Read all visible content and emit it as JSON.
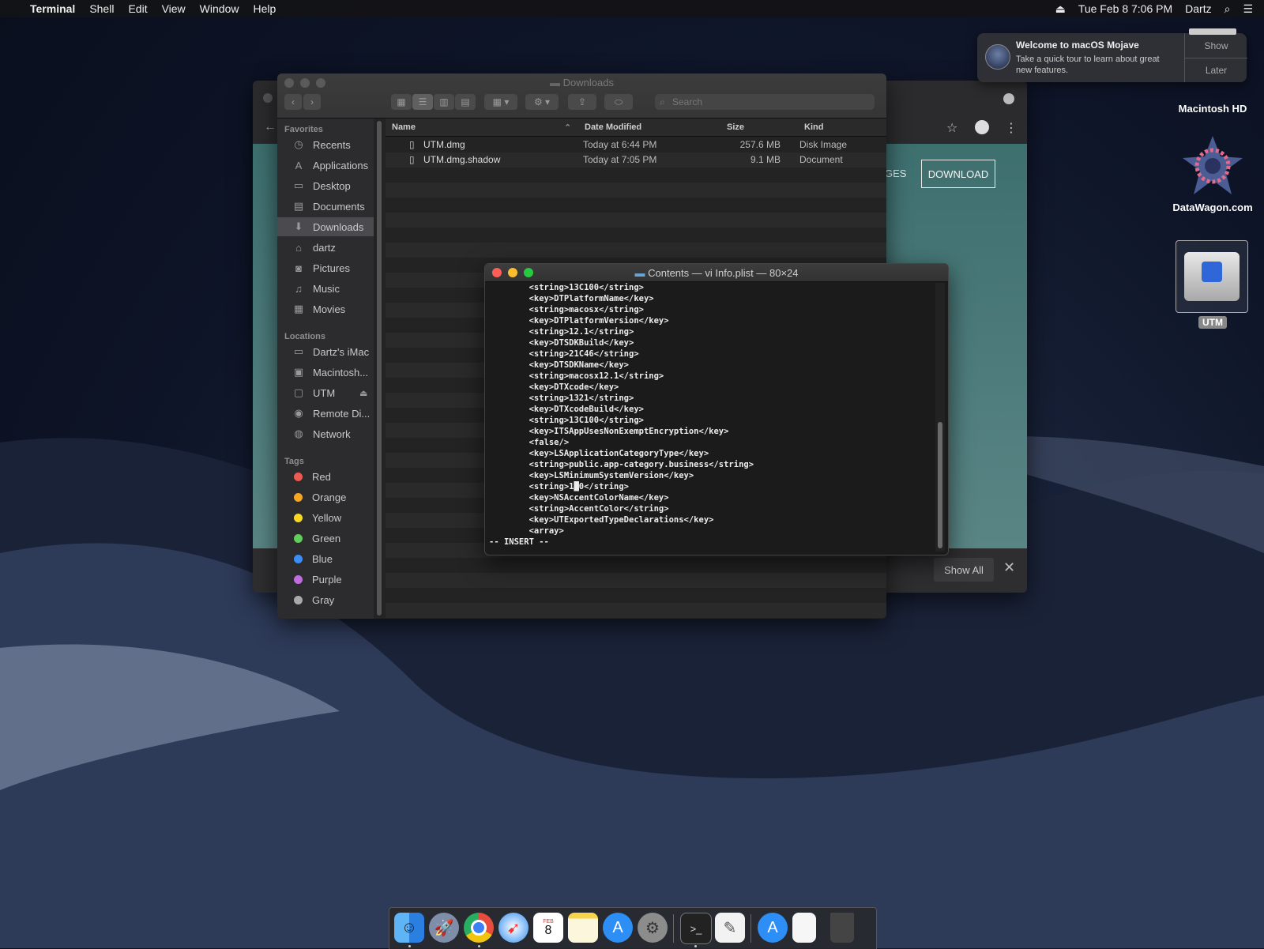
{
  "menubar": {
    "app": "Terminal",
    "items": [
      "Shell",
      "Edit",
      "View",
      "Window",
      "Help"
    ],
    "clock": "Tue Feb 8  7:06 PM",
    "user": "Dartz"
  },
  "notification": {
    "title": "Welcome to macOS Mojave",
    "body": "Take a quick tour to learn about great new features.",
    "show": "Show",
    "later": "Later"
  },
  "desktop": {
    "icons": [
      {
        "label": "Macintosh HD"
      },
      {
        "label": "DataWagon.com"
      },
      {
        "label": "UTM"
      }
    ]
  },
  "browser": {
    "nav_partial": "GES",
    "download_button": "DOWNLOAD",
    "show_all": "Show All"
  },
  "finder": {
    "title": "Downloads",
    "search_placeholder": "Search",
    "favorites_header": "Favorites",
    "favorites": [
      {
        "label": "Recents",
        "icon": "clock"
      },
      {
        "label": "Applications",
        "icon": "apps"
      },
      {
        "label": "Desktop",
        "icon": "desktop"
      },
      {
        "label": "Documents",
        "icon": "doc"
      },
      {
        "label": "Downloads",
        "icon": "download"
      },
      {
        "label": "dartz",
        "icon": "home"
      },
      {
        "label": "Pictures",
        "icon": "camera"
      },
      {
        "label": "Music",
        "icon": "music"
      },
      {
        "label": "Movies",
        "icon": "film"
      }
    ],
    "locations_header": "Locations",
    "locations": [
      {
        "label": "Dartz's iMac",
        "icon": "imac"
      },
      {
        "label": "Macintosh...",
        "icon": "disk"
      },
      {
        "label": "UTM",
        "icon": "disk"
      },
      {
        "label": "Remote Di...",
        "icon": "cd"
      },
      {
        "label": "Network",
        "icon": "globe"
      }
    ],
    "tags_header": "Tags",
    "tags": [
      {
        "label": "Red",
        "color": "#ee5a52"
      },
      {
        "label": "Orange",
        "color": "#f5a623"
      },
      {
        "label": "Yellow",
        "color": "#f8d825"
      },
      {
        "label": "Green",
        "color": "#5fcf5a"
      },
      {
        "label": "Blue",
        "color": "#3a8ef7"
      },
      {
        "label": "Purple",
        "color": "#bf6ddc"
      },
      {
        "label": "Gray",
        "color": "#a9a9a9"
      }
    ],
    "columns": {
      "name": "Name",
      "date": "Date Modified",
      "size": "Size",
      "kind": "Kind"
    },
    "files": [
      {
        "name": "UTM.dmg",
        "date": "Today at 6:44 PM",
        "size": "257.6 MB",
        "kind": "Disk Image"
      },
      {
        "name": "UTM.dmg.shadow",
        "date": "Today at 7:05 PM",
        "size": "9.1 MB",
        "kind": "Document"
      }
    ]
  },
  "terminal": {
    "title": "Contents — vi Info.plist — 80×24",
    "lines": [
      "        <string>13C100</string>",
      "        <key>DTPlatformName</key>",
      "        <string>macosx</string>",
      "        <key>DTPlatformVersion</key>",
      "        <string>12.1</string>",
      "        <key>DTSDKBuild</key>",
      "        <string>21C46</string>",
      "        <key>DTSDKName</key>",
      "        <string>macosx12.1</string>",
      "        <key>DTXcode</key>",
      "        <string>1321</string>",
      "        <key>DTXcodeBuild</key>",
      "        <string>13C100</string>",
      "        <key>ITSAppUsesNonExemptEncryption</key>",
      "        <false/>",
      "        <key>LSApplicationCategoryType</key>",
      "        <string>public.app-category.business</string>",
      "        <key>LSMinimumSystemVersion</key>",
      "        <string>1█0</string>",
      "        <key>NSAccentColorName</key>",
      "        <string>AccentColor</string>",
      "        <key>UTExportedTypeDeclarations</key>",
      "        <array>",
      "-- INSERT --"
    ]
  },
  "dock": {
    "apps": [
      "finder",
      "launchpad",
      "chrome",
      "safari",
      "calendar",
      "notes",
      "app-store",
      "system-preferences",
      "terminal",
      "textedit",
      "app-store-2",
      "document",
      "trash"
    ],
    "calendar_day": "8",
    "calendar_month": "FEB"
  }
}
